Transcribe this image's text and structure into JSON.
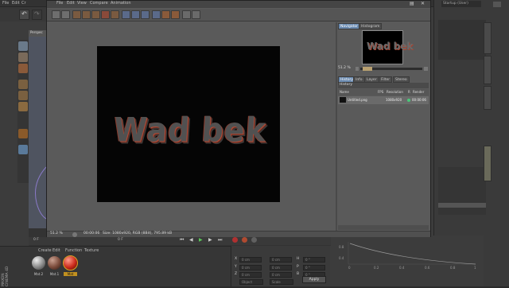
{
  "c4d": {
    "menu": [
      "File",
      "Edit",
      "Cr"
    ],
    "right_header": "Startup (User)",
    "viewport_tab": "Perspec",
    "frame_left": "0 F",
    "frame_right": "0 F",
    "material_menu": [
      "Create",
      "Edit",
      "Function",
      "Texture"
    ],
    "materials": [
      {
        "label": "Mat.2",
        "color": "#9a9a9a"
      },
      {
        "label": "Mat.1",
        "color": "#8a5a4a"
      },
      {
        "label": "Mat",
        "color": "#cc2a1a"
      }
    ],
    "coords": {
      "rows": [
        {
          "axis": "X",
          "v1": "0 cm",
          "v2": "0 cm",
          "axis3": "H",
          "v3": "0 °"
        },
        {
          "axis": "Y",
          "v1": "0 cm",
          "v2": "0 cm",
          "axis3": "P",
          "v3": "0 °"
        },
        {
          "axis": "Z",
          "v1": "0 cm",
          "v2": "0 cm",
          "axis3": "B",
          "v3": "0 °"
        }
      ],
      "mode1": "Object",
      "mode2": "Scale",
      "apply": "Apply"
    },
    "graph_ticks": [
      "0",
      "0.2",
      "0.4",
      "0.6",
      "0.8",
      "1"
    ],
    "graph_y": [
      "0.8",
      "0.4"
    ],
    "logo_line1": "MAXON",
    "logo_line2": "CINEMA 4D",
    "colors": {
      "accent": "#6a8ab0",
      "render_shadow": "#b04a36"
    }
  },
  "picture_viewer": {
    "menu": [
      "File",
      "Edit",
      "View",
      "Compare",
      "Animation"
    ],
    "render_text": "Wad bek",
    "thumb_text": "Wad bek",
    "nav_tabs": [
      "Navigator",
      "Histogram"
    ],
    "zoom": "51.2 %",
    "lower_tabs": [
      "History",
      "Info",
      "Layer",
      "Filter",
      "Stereo"
    ],
    "history_header": "History",
    "columns": [
      "Name",
      "FPS",
      "Resolution",
      "R",
      "Render"
    ],
    "history_row": {
      "name": "Untitled.png",
      "resolution": "1080x920",
      "render": "00:00:06"
    },
    "status": {
      "zoom": "51.2 %",
      "time": "00:00:06",
      "info": "Size: 1080x920, RGB (8Bit), 795.89 kB"
    }
  }
}
